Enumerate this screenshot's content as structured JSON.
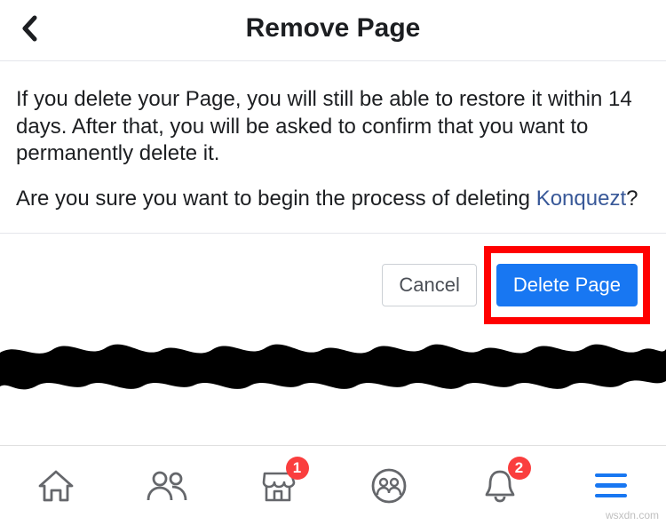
{
  "header": {
    "title": "Remove Page"
  },
  "content": {
    "paragraph1": "If you delete your Page, you will still be able to restore it within 14 days. After that, you will be asked to confirm that you want to permanently delete it.",
    "paragraph2_prefix": "Are you sure you want to begin the process of deleting ",
    "page_name": "Konquezt",
    "paragraph2_suffix": "?"
  },
  "actions": {
    "cancel": "Cancel",
    "delete": "Delete Page"
  },
  "nav": {
    "marketplace_badge": "1",
    "notifications_badge": "2"
  },
  "watermark": "wsxdn.com"
}
